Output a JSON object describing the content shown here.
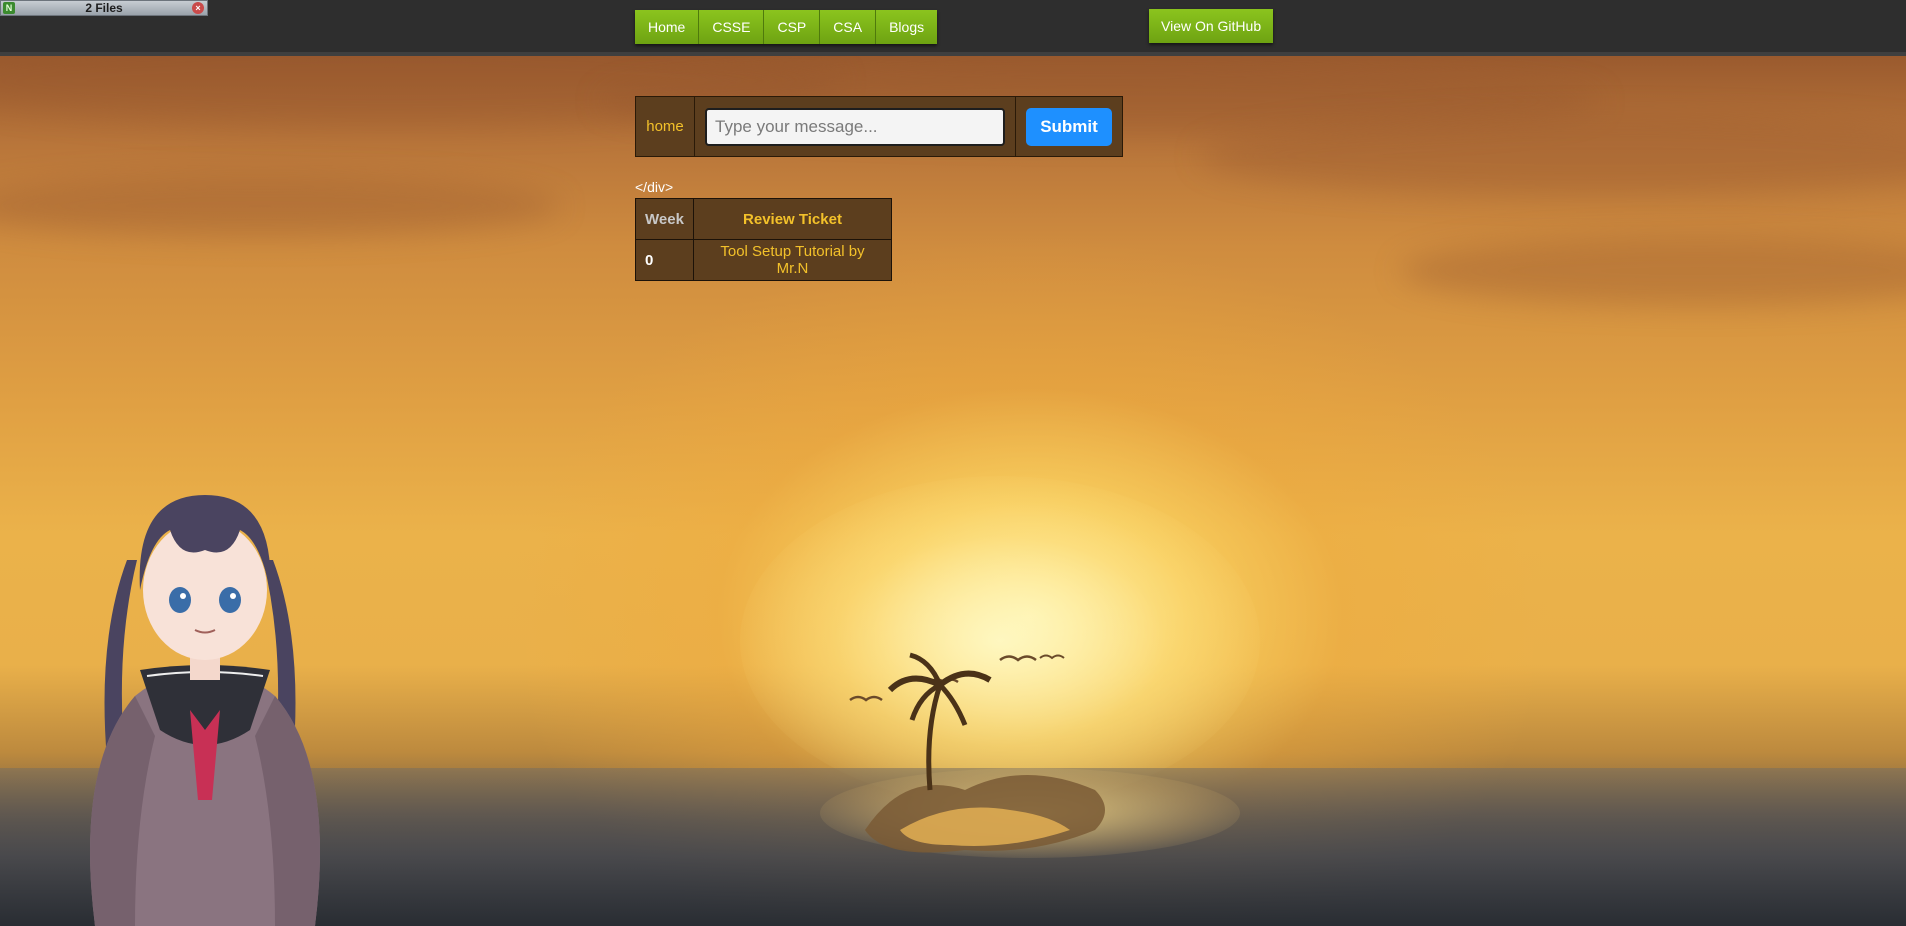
{
  "file_widget": {
    "title": "2 Files",
    "icon": "file-manager-icon",
    "close_icon": "close-icon"
  },
  "nav": {
    "items": [
      {
        "label": "Home"
      },
      {
        "label": "CSSE"
      },
      {
        "label": "CSP"
      },
      {
        "label": "CSA"
      },
      {
        "label": "Blogs"
      }
    ],
    "github_label": "View On GitHub"
  },
  "form": {
    "page_label": "home",
    "input_placeholder": "Type your message...",
    "input_value": "",
    "submit_label": "Submit"
  },
  "stray_text": "</div>",
  "table": {
    "headers": [
      "Week",
      "Review Ticket"
    ],
    "rows": [
      {
        "week": "0",
        "ticket": "Tool Setup Tutorial by Mr.N"
      }
    ]
  },
  "colors": {
    "nav_green": "#7cb518",
    "label_gold": "#f3c12a",
    "submit_blue": "#1e90ff",
    "cell_brown": "#5c3e1e"
  },
  "background": {
    "scene": "sunset over ocean with small palm island and birds",
    "character": "anime girl in sailor uniform"
  }
}
